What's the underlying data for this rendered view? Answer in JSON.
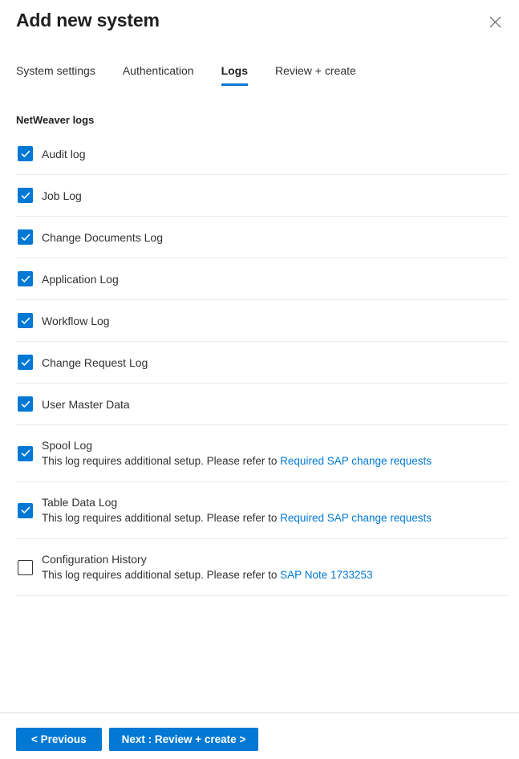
{
  "header": {
    "title": "Add new system",
    "close_icon": "close-icon"
  },
  "tabs": [
    {
      "label": "System settings",
      "active": false
    },
    {
      "label": "Authentication",
      "active": false
    },
    {
      "label": "Logs",
      "active": true
    },
    {
      "label": "Review + create",
      "active": false
    }
  ],
  "section": {
    "title": "NetWeaver logs"
  },
  "logs": [
    {
      "label": "Audit log",
      "checked": true,
      "desc": "",
      "link": ""
    },
    {
      "label": "Job Log",
      "checked": true,
      "desc": "",
      "link": ""
    },
    {
      "label": "Change Documents Log",
      "checked": true,
      "desc": "",
      "link": ""
    },
    {
      "label": "Application Log",
      "checked": true,
      "desc": "",
      "link": ""
    },
    {
      "label": "Workflow Log",
      "checked": true,
      "desc": "",
      "link": ""
    },
    {
      "label": "Change Request Log",
      "checked": true,
      "desc": "",
      "link": ""
    },
    {
      "label": "User Master Data",
      "checked": true,
      "desc": "",
      "link": ""
    },
    {
      "label": "Spool Log",
      "checked": true,
      "desc": "This log requires additional setup. Please refer to ",
      "link": "Required SAP change requests"
    },
    {
      "label": "Table Data Log",
      "checked": true,
      "desc": "This log requires additional setup. Please refer to ",
      "link": "Required SAP change requests"
    },
    {
      "label": "Configuration History",
      "checked": false,
      "desc": "This log requires additional setup. Please refer to ",
      "link": "SAP Note 1733253"
    }
  ],
  "footer": {
    "previous_label": "< Previous",
    "next_label": "Next : Review + create >"
  },
  "colors": {
    "accent": "#0078d4",
    "link": "#0078d4",
    "text": "#323130",
    "divider": "#edebe9",
    "footer_divider": "#e1dfdd"
  }
}
